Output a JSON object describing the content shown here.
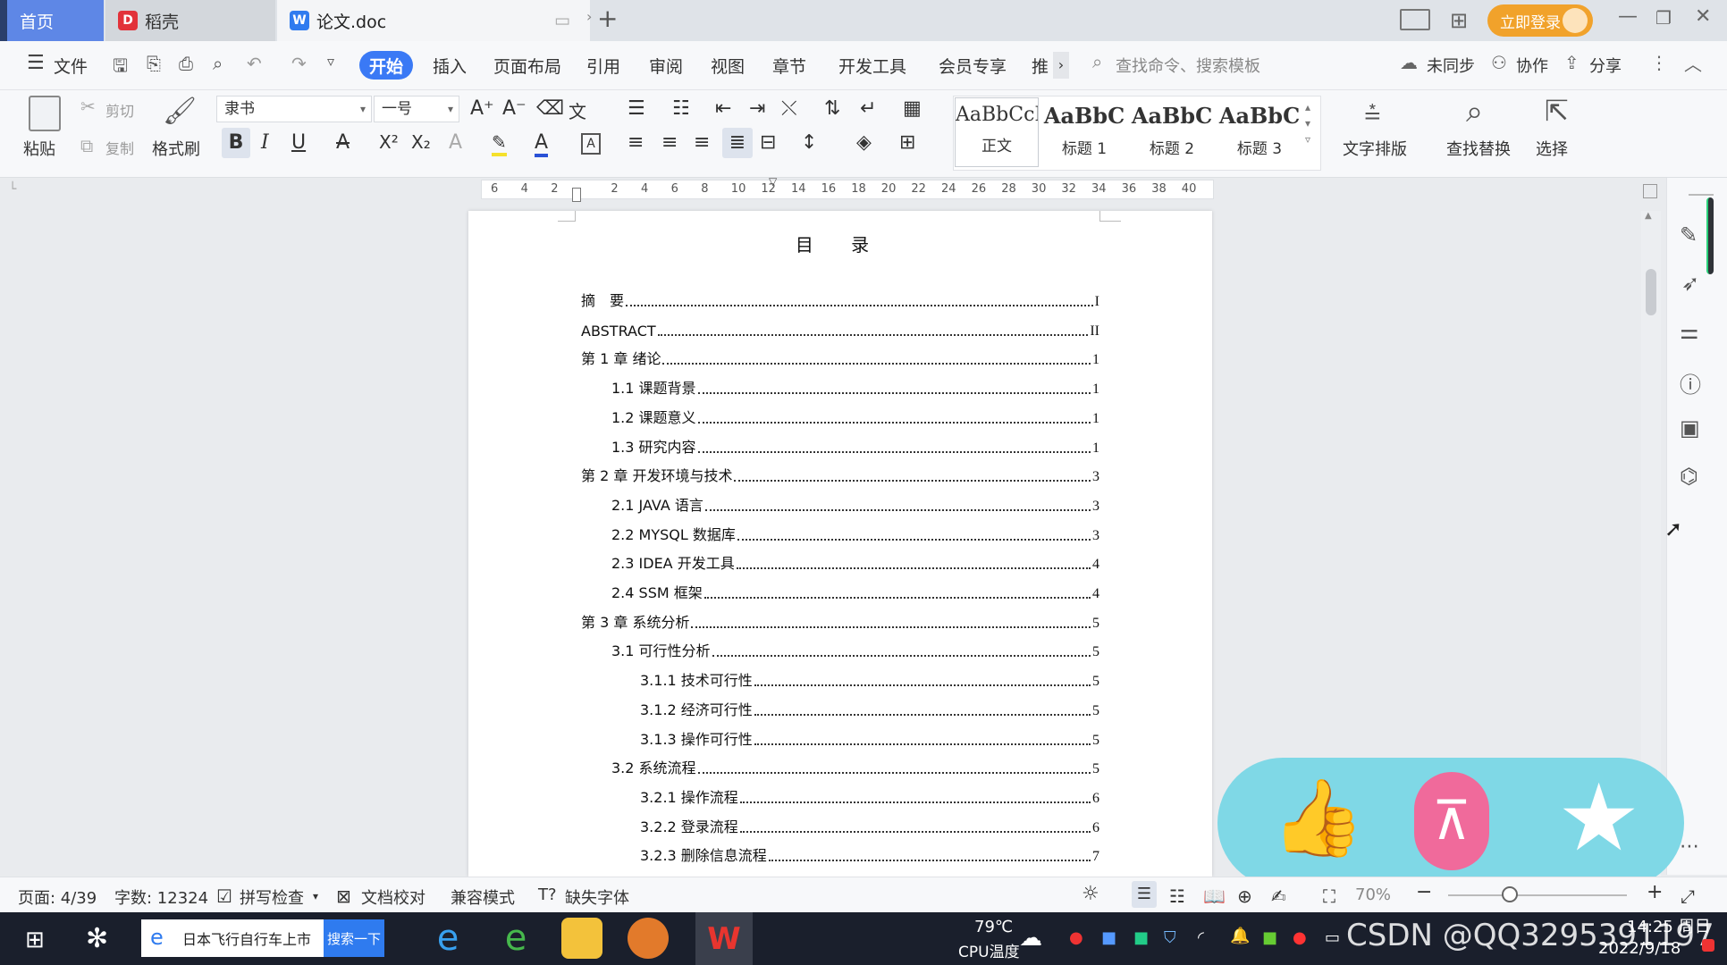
{
  "titlebar": {
    "tab_home": "首页",
    "tab_docer": "稻壳",
    "tab_doc": "论文.doc",
    "login": "立即登录"
  },
  "menu": {
    "file": "文件",
    "items": [
      "开始",
      "插入",
      "页面布局",
      "引用",
      "审阅",
      "视图",
      "章节",
      "开发工具",
      "会员专享",
      "推"
    ],
    "search_placeholder": "查找命令、搜索模板",
    "unsync": "未同步",
    "collab": "协作",
    "share": "分享"
  },
  "ribbon": {
    "paste": "粘贴",
    "cut": "剪切",
    "copy": "复制",
    "format_painter": "格式刷",
    "font_name": "隶书",
    "font_size": "一号",
    "styles": [
      {
        "preview": "AaBbCcI",
        "label": "正文"
      },
      {
        "preview": "AaBbC",
        "label": "标题 1"
      },
      {
        "preview": "AaBbC",
        "label": "标题 2"
      },
      {
        "preview": "AaBbC",
        "label": "标题 3"
      }
    ],
    "text_layout": "文字排版",
    "find_replace": "查找替换",
    "select": "选择"
  },
  "ruler": {
    "ticks": [
      "6",
      "4",
      "2",
      "",
      "2",
      "4",
      "6",
      "8",
      "10",
      "12",
      "14",
      "16",
      "18",
      "20",
      "22",
      "24",
      "26",
      "28",
      "30",
      "32",
      "34",
      "36",
      "38",
      "40"
    ]
  },
  "document": {
    "title": "目 录",
    "toc": [
      {
        "text": "摘　要",
        "page": "I",
        "level": 0
      },
      {
        "text": "ABSTRACT",
        "page": "II",
        "level": 0
      },
      {
        "text": "第 1 章  绪论",
        "page": "1",
        "level": 0
      },
      {
        "text": "1.1  课题背景",
        "page": "1",
        "level": 1
      },
      {
        "text": "1.2  课题意义",
        "page": "1",
        "level": 1
      },
      {
        "text": "1.3  研究内容",
        "page": "1",
        "level": 1
      },
      {
        "text": "第 2 章  开发环境与技术",
        "page": "3",
        "level": 0
      },
      {
        "text": "2.1 JAVA 语言",
        "page": "3",
        "level": 1
      },
      {
        "text": "2.2 MYSQL 数据库",
        "page": "3",
        "level": 1
      },
      {
        "text": "2.3 IDEA 开发工具",
        "page": "4",
        "level": 1
      },
      {
        "text": "2.4 SSM 框架",
        "page": "4",
        "level": 1
      },
      {
        "text": "第 3 章  系统分析",
        "page": "5",
        "level": 0
      },
      {
        "text": "3.1  可行性分析",
        "page": "5",
        "level": 1
      },
      {
        "text": "3.1.1  技术可行性",
        "page": "5",
        "level": 2
      },
      {
        "text": "3.1.2  经济可行性",
        "page": "5",
        "level": 2
      },
      {
        "text": "3.1.3  操作可行性",
        "page": "5",
        "level": 2
      },
      {
        "text": "3.2  系统流程",
        "page": "5",
        "level": 1
      },
      {
        "text": "3.2.1  操作流程",
        "page": "6",
        "level": 2
      },
      {
        "text": "3.2.2  登录流程",
        "page": "6",
        "level": 2
      },
      {
        "text": "3.2.3  删除信息流程",
        "page": "7",
        "level": 2
      }
    ]
  },
  "statusbar": {
    "page": "页面: 4/39",
    "words": "字数: 12324",
    "spellcheck": "拼写检查",
    "doc_check": "文档校对",
    "compat": "兼容模式",
    "missing_font": "缺失字体",
    "zoom": "70%"
  },
  "taskbar": {
    "search_text": "日本飞行自行车上市",
    "search_btn": "搜索一下",
    "temp": "79℃",
    "temp_label": "CPU温度",
    "watermark": "CSDN @QQ3295391197",
    "time": "14:25 周日",
    "date": "2022/9/18"
  },
  "colors": {
    "accent": "#3a79f5",
    "login": "#f1a22b",
    "reaction_bg": "#7fd8e6",
    "reaction_pink": "#f06a9b"
  }
}
